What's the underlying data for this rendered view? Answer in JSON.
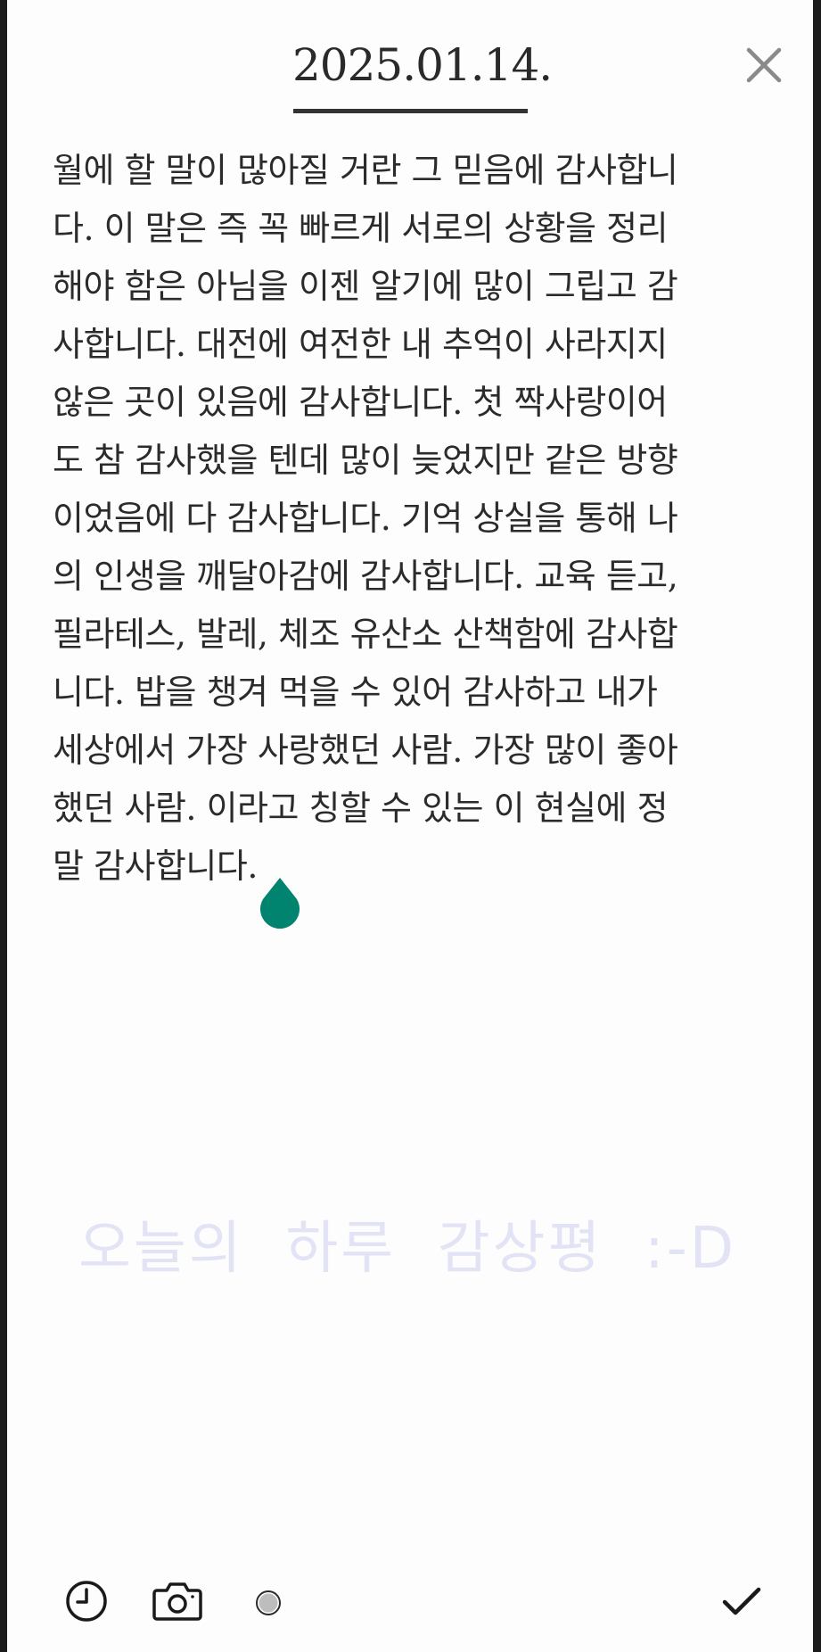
{
  "header": {
    "date": "2025.01.14."
  },
  "body": {
    "lines": [
      "월에 할 말이 많아질 거란 그 믿음에 감사합니",
      "다. 이 말은 즉 꼭 빠르게 서로의 상황을 정리",
      "해야 함은 아님을 이젠 알기에 많이 그립고 감",
      "사합니다. 대전에 여전한 내 추억이 사라지지",
      "않은 곳이 있음에 감사합니다. 첫 짝사랑이어",
      "도 참 감사했을 텐데 많이 늦었지만 같은 방향",
      "이었음에 다 감사합니다. 기억 상실을 통해 나",
      "의 인생을 깨달아감에 감사합니다. 교육 듣고,",
      "필라테스, 발레, 체조 유산소 산책함에 감사합",
      "니다. 밥을 챙겨 먹을 수 있어 감사하고 내가",
      "세상에서 가장 사랑했던 사람. 가장 많이 좋아",
      "했던 사람. 이라고 칭할 수 있는 이 현실에 정",
      "말 감사합니다."
    ]
  },
  "review": {
    "placeholder": "오늘의  하루  감상평  :-D"
  },
  "toolbar": {
    "icons": [
      "clock-icon",
      "camera-icon",
      "mood-dot-icon",
      "checkmark-icon"
    ]
  },
  "colors": {
    "accent": "#00836f",
    "placeholder": "#e3e3f6",
    "text": "#2b2b2b",
    "page": "#fdfdfd",
    "frame": "#1c1c1c"
  }
}
